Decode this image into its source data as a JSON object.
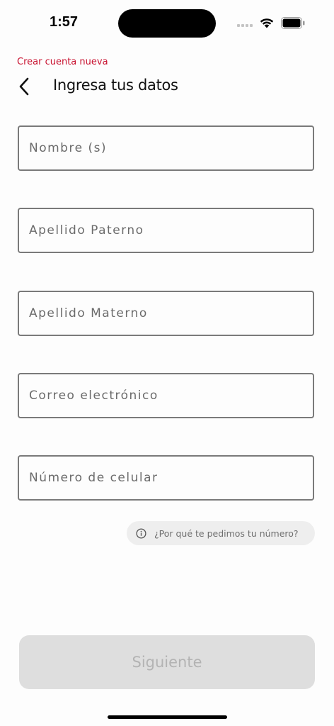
{
  "status_bar": {
    "time": "1:57"
  },
  "header": {
    "overline": "Crear cuenta nueva",
    "title": "Ingresa tus datos",
    "overline_color": "#c8102e"
  },
  "form": {
    "fields": [
      {
        "placeholder": "Nombre (s)",
        "value": ""
      },
      {
        "placeholder": "Apellido Paterno",
        "value": ""
      },
      {
        "placeholder": "Apellido Materno",
        "value": ""
      },
      {
        "placeholder": "Correo electrónico",
        "value": ""
      },
      {
        "placeholder": "Número de celular",
        "value": ""
      }
    ],
    "info_text": "¿Por qué te pedimos tu número?",
    "info_icon": "info-circle-icon"
  },
  "footer": {
    "next_label": "Siguiente",
    "next_disabled": true
  }
}
